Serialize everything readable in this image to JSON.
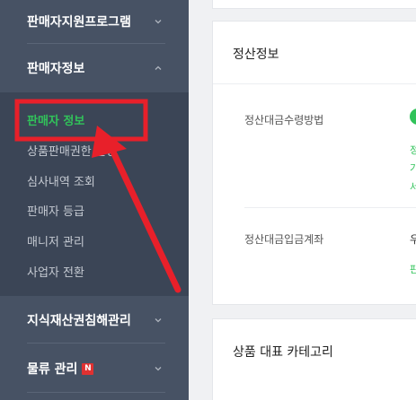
{
  "sidebar": {
    "sections": [
      {
        "label": "판매자지원프로그램"
      },
      {
        "label": "판매자정보"
      },
      {
        "label": "지식재산권침해관리"
      },
      {
        "label": "물류 관리",
        "badge": "N"
      }
    ],
    "items": [
      {
        "label": "판매자 정보"
      },
      {
        "label": "상품판매권한 신청"
      },
      {
        "label": "심사내역 조회"
      },
      {
        "label": "판매자 등급"
      },
      {
        "label": "매니저 관리"
      },
      {
        "label": "사업자 전환"
      }
    ]
  },
  "main": {
    "settlement": {
      "title": "정산정보",
      "method_label": "정산대금수령방법",
      "method_lines": [
        "정",
        "기",
        "서"
      ],
      "account_label": "정산대금입금계좌",
      "account_value": "우",
      "account_link": "판"
    },
    "category": {
      "title": "상품 대표 카테고리"
    }
  },
  "colors": {
    "sidebar_bg": "#475264",
    "submenu_bg": "#3b4556",
    "accent_green": "#31c35a",
    "highlight_red": "#e8202a"
  }
}
